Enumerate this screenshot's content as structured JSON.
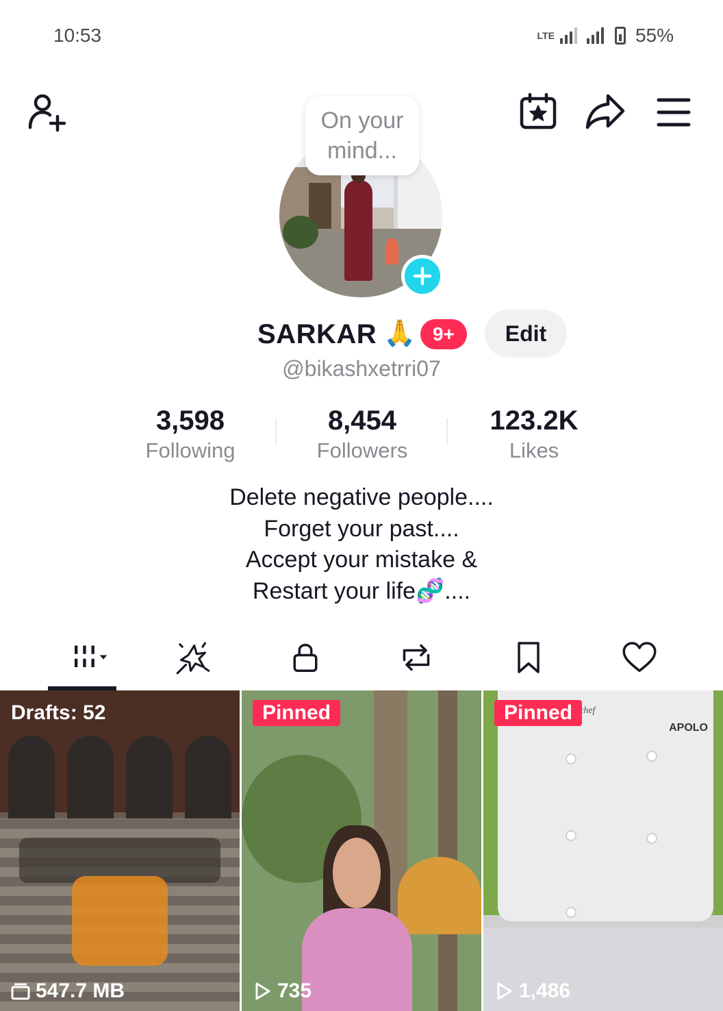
{
  "status_bar": {
    "time": "10:53",
    "network": "LTE",
    "battery": "55%"
  },
  "header": {
    "note_bubble": "On your mind...",
    "icons": [
      "add-friend-icon",
      "calendar-star-icon",
      "share-icon",
      "menu-icon"
    ]
  },
  "profile": {
    "display_name": "SARKAR",
    "name_emoji": "🙏",
    "notification_badge": "9+",
    "edit_label": "Edit",
    "username": "@bikashxetrri07"
  },
  "stats": {
    "following": {
      "value": "3,598",
      "label": "Following"
    },
    "followers": {
      "value": "8,454",
      "label": "Followers"
    },
    "likes": {
      "value": "123.2K",
      "label": "Likes"
    }
  },
  "bio": {
    "line1": "Delete negative people....",
    "line2": "Forget your past....",
    "line3": "Accept your mistake &",
    "line4": "Restart your life🧬...."
  },
  "tabs": [
    {
      "name": "videos",
      "icon": "grid-icon",
      "active": true
    },
    {
      "name": "reposts-sparkle",
      "icon": "sparkle-icon"
    },
    {
      "name": "private",
      "icon": "lock-icon"
    },
    {
      "name": "reposts",
      "icon": "repost-icon"
    },
    {
      "name": "saved",
      "icon": "bookmark-icon"
    },
    {
      "name": "liked",
      "icon": "heart-icon"
    }
  ],
  "videos": [
    {
      "top_label": "Drafts: 52",
      "bottom_label": "547.7 MB",
      "bottom_icon": "folder-icon"
    },
    {
      "top_label": "Pinned",
      "bottom_label": "735",
      "bottom_icon": "play-icon"
    },
    {
      "top_label": "Pinned",
      "bottom_label": "1,486",
      "bottom_icon": "play-icon",
      "text_in_image": [
        "chef",
        "APOLO"
      ]
    }
  ],
  "colors": {
    "accent_red": "#fe2c55",
    "accent_cyan": "#20d5ec",
    "text_primary": "#161823",
    "text_secondary": "#8a8b91"
  }
}
